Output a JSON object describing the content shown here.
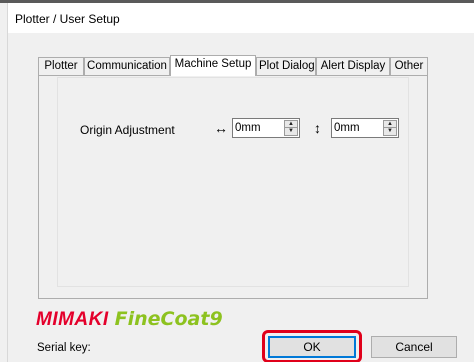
{
  "window": {
    "title": "Plotter / User Setup"
  },
  "tabs": [
    {
      "label": "Plotter",
      "active": false
    },
    {
      "label": "Communication",
      "active": false
    },
    {
      "label": "Machine Setup",
      "active": true
    },
    {
      "label": "Plot Dialog",
      "active": false
    },
    {
      "label": "Alert Display",
      "active": false
    },
    {
      "label": "Other",
      "active": false
    }
  ],
  "origin_adjustment": {
    "label": "Origin Adjustment",
    "horizontal_icon": "↔",
    "horizontal_value": "0mm",
    "vertical_icon": "↕",
    "vertical_value": "0mm"
  },
  "logo": {
    "brand": "MIMAKI",
    "product": "FineCoat9",
    "brand_color": "#e4002b",
    "product_color": "#8dc21f"
  },
  "footer": {
    "serial_label": "Serial key:",
    "ok_label": "OK",
    "cancel_label": "Cancel",
    "highlight_color": "#e0001a"
  }
}
